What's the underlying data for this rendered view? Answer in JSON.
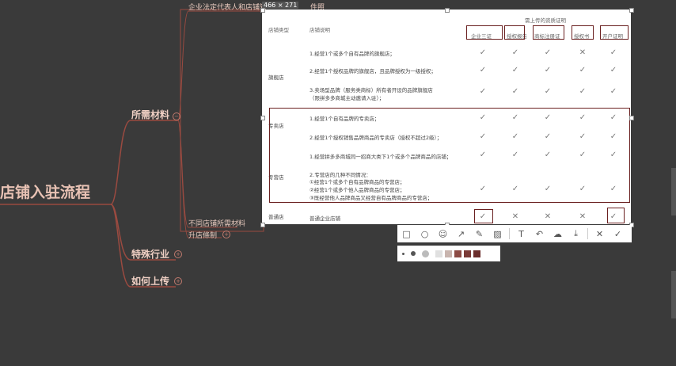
{
  "mindmap": {
    "root": "店铺入驻流程",
    "branch_required_materials": "所需材料",
    "branch_special_industry": "特殊行业",
    "branch_how_to_upload": "如何上传",
    "sub_legal_rep": "企业法定代表人和店铺管",
    "sub_legal_rep_suffix": "件照",
    "sub_store_materials": "不同店铺所需材料",
    "sub_open_store": "升店條制"
  },
  "screenshot_overlay": {
    "size_label": "466 × 271",
    "header": {
      "col_type": "店铺类型",
      "col_desc": "店铺说明",
      "col_required_title": "需上传的资质证明",
      "col_license": "企业三证",
      "col_auth": "授权报告",
      "col_trademark": "商标注册证",
      "col_authorization": "授权书",
      "col_account": "开户证明"
    },
    "rows": [
      {
        "type": "旗舰店",
        "desc": "1.经营1个或多个自有品牌的旗舰店；",
        "marks": [
          "✓",
          "✓",
          "✓",
          "✕",
          "✓"
        ]
      },
      {
        "type": "",
        "desc": "2.经营1个授权品牌的旗舰店，且品牌授权为一级授权；",
        "marks": [
          "✓",
          "✓",
          "✓",
          "✓",
          "✓"
        ]
      },
      {
        "type": "",
        "desc": "3.卖场型品牌（服务类商标）所有者开设的品牌旗舰店",
        "desc2": "（限拼多多商城主动邀请入驻）；",
        "marks": [
          "✓",
          "✓",
          "✓",
          "✓",
          "✓"
        ]
      },
      {
        "type": "专卖店",
        "desc": "1.经营1个自有品牌的专卖店；",
        "marks": [
          "✓",
          "✓",
          "✓",
          "✓",
          "✓"
        ]
      },
      {
        "type": "",
        "desc": "2.经营1个授权销售品牌商品的专卖店（授权不超过2级）；",
        "marks": [
          "✓",
          "✓",
          "✓",
          "✓",
          "✓"
        ]
      },
      {
        "type": "专营店",
        "desc": "1.经营拼多多商城同一招商大类下1个或多个品牌商品的店铺；",
        "marks": [
          "✓",
          "✓",
          "✓",
          "✓",
          "✓"
        ]
      },
      {
        "type": "",
        "desc": "2.专营店的几种不同情况：",
        "desc2": "①经营1个或多个自有品牌商品的专营店；",
        "desc3": "②经营1个或多个他人品牌商品的专营店；",
        "desc4": "③既经营他人品牌商品又经营自有品牌商品的专营店；",
        "marks": [
          "✓",
          "✓",
          "✓",
          "✓",
          "✓"
        ]
      },
      {
        "type": "普通店",
        "desc": "普通企业店铺",
        "marks": [
          "✓",
          "✕",
          "✕",
          "✕",
          "✓"
        ]
      }
    ]
  },
  "toolbar": {
    "tools": [
      "rect-icon",
      "circle-icon",
      "mosaic-icon",
      "arrow-icon",
      "pen-icon",
      "marker-icon",
      "text-icon",
      "undo-icon",
      "cloud-icon",
      "download-icon",
      "close-icon",
      "check-icon"
    ],
    "glyphs": [
      "□",
      "○",
      "☺",
      "↗",
      "✎",
      "▨",
      "T",
      "↶",
      "☁",
      "⤓",
      "✕",
      "✓"
    ]
  },
  "palette": {
    "colors": [
      "#e0e0e0",
      "#c8b4ae",
      "#8c4a44",
      "#7a3a36",
      "#6b2e2c"
    ]
  },
  "colors": {
    "background": "#3a3a3a",
    "line": "#9a4a40",
    "box": "#6a2020"
  }
}
